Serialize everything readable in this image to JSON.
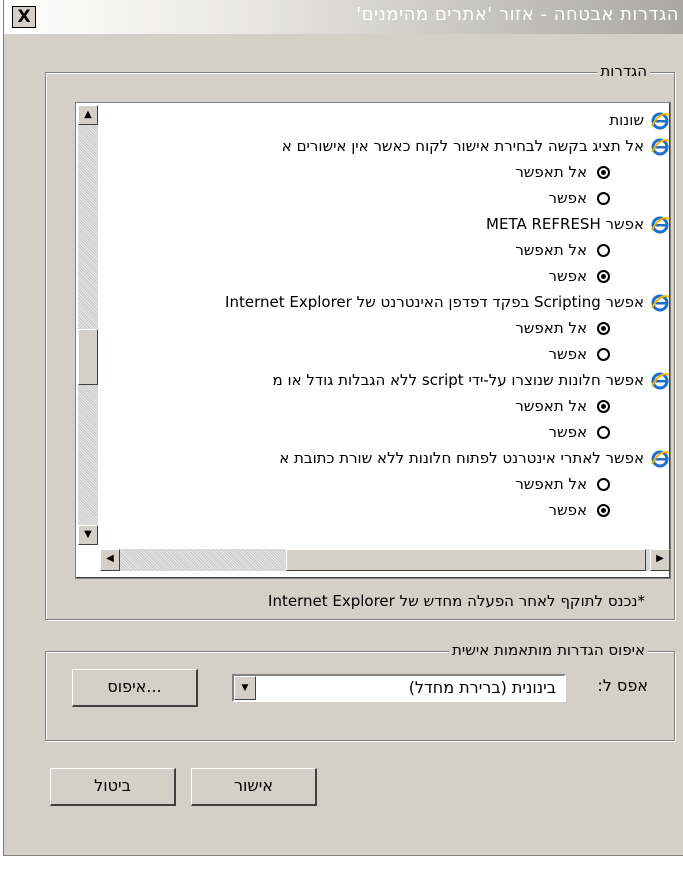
{
  "window": {
    "title": "הגדרות אבטחה - אזור 'אתרים מהימנים'",
    "close_label": "X"
  },
  "settings_group": {
    "legend": "הגדרות",
    "items": [
      {
        "kind": "header",
        "label": "שונות"
      },
      {
        "kind": "setting",
        "label": "אל תציג בקשה לבחירת אישור לקוח כאשר אין אישורים א"
      },
      {
        "kind": "option",
        "label": "אל תאפשר",
        "selected": true
      },
      {
        "kind": "option",
        "label": "אפשר",
        "selected": false
      },
      {
        "kind": "setting",
        "label": "אפשר META REFRESH"
      },
      {
        "kind": "option",
        "label": "אל תאפשר",
        "selected": false
      },
      {
        "kind": "option",
        "label": "אפשר",
        "selected": true
      },
      {
        "kind": "setting",
        "label": "אפשר Scripting בפקד דפדפן האינטרנט של Internet Explorer"
      },
      {
        "kind": "option",
        "label": "אל תאפשר",
        "selected": true
      },
      {
        "kind": "option",
        "label": "אפשר",
        "selected": false
      },
      {
        "kind": "setting",
        "label": "אפשר חלונות שנוצרו על-ידי script ללא הגבלות גודל או מ"
      },
      {
        "kind": "option",
        "label": "אל תאפשר",
        "selected": true
      },
      {
        "kind": "option",
        "label": "אפשר",
        "selected": false
      },
      {
        "kind": "setting",
        "label": "אפשר לאתרי אינטרנט לפתוח חלונות ללא שורת כתובת א"
      },
      {
        "kind": "option",
        "label": "אל תאפשר",
        "selected": false
      },
      {
        "kind": "option",
        "label": "אפשר",
        "selected": true
      }
    ],
    "note": "*נכנס לתוקף לאחר הפעלה מחדש של Internet Explorer"
  },
  "reset_group": {
    "legend": "איפוס הגדרות מותאמות אישית",
    "reset_to_label": "אפס ל:",
    "reset_level_value": "בינונית (ברירת מחדל)",
    "reset_button": "איפוס..."
  },
  "footer": {
    "ok_button": "אישור",
    "cancel_button": "ביטול"
  }
}
